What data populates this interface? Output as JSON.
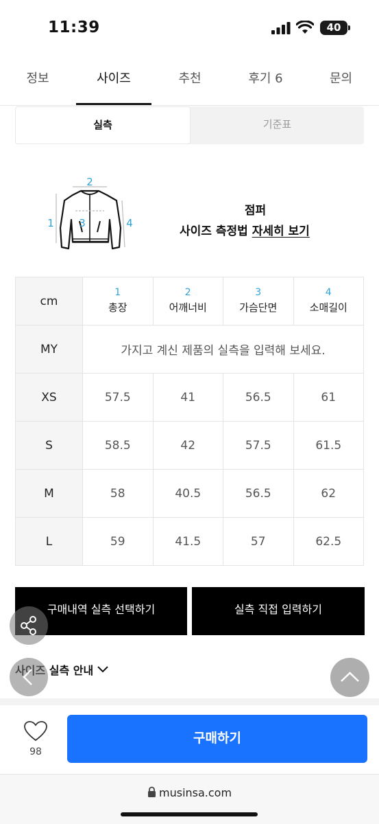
{
  "status": {
    "time": "11:39",
    "battery": "40"
  },
  "tabs": [
    {
      "label": "정보"
    },
    {
      "label": "사이즈"
    },
    {
      "label": "추천"
    },
    {
      "label": "후기 6"
    },
    {
      "label": "문의"
    }
  ],
  "segmented": {
    "active": "실측",
    "inactive": "기준표"
  },
  "diagram": {
    "labels": [
      "1",
      "2",
      "3",
      "4"
    ]
  },
  "product": {
    "type": "점퍼",
    "measure_prefix": "사이즈 측정법 ",
    "measure_link": "자세히 보기"
  },
  "table": {
    "unit": "cm",
    "columns": [
      {
        "num": "1",
        "name": "총장"
      },
      {
        "num": "2",
        "name": "어깨너비"
      },
      {
        "num": "3",
        "name": "가슴단면"
      },
      {
        "num": "4",
        "name": "소매길이"
      }
    ],
    "my_label": "MY",
    "my_message": "가지고 계신 제품의 실측을 입력해 보세요.",
    "rows": [
      {
        "size": "XS",
        "values": [
          "57.5",
          "41",
          "56.5",
          "61"
        ]
      },
      {
        "size": "S",
        "values": [
          "58.5",
          "42",
          "57.5",
          "61.5"
        ]
      },
      {
        "size": "M",
        "values": [
          "58",
          "40.5",
          "56.5",
          "62"
        ]
      },
      {
        "size": "L",
        "values": [
          "59",
          "41.5",
          "57",
          "62.5"
        ]
      }
    ]
  },
  "buttons": {
    "history": "구매내역 실측 선택하기",
    "direct": "실측 직접 입력하기"
  },
  "size_guide": "사이즈 실측 안내",
  "bottom": {
    "like_count": "98",
    "buy": "구매하기"
  },
  "browser": {
    "url": "musinsa.com"
  },
  "colors": {
    "accent_blue": "#1a73ff",
    "diagram_blue": "#2ea3d8"
  }
}
